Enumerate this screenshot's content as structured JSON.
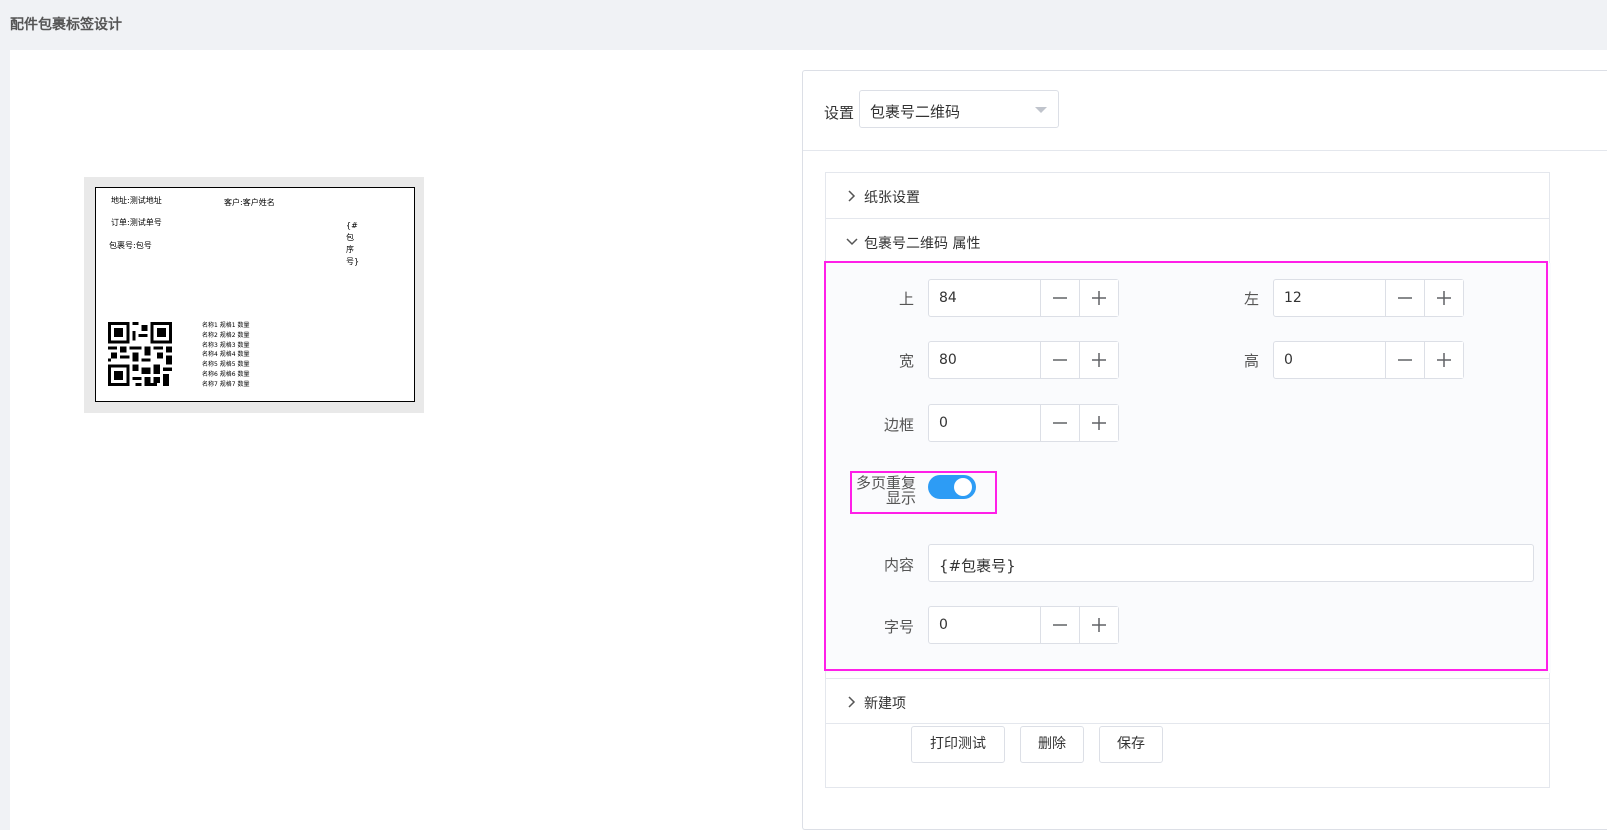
{
  "page": {
    "title": "配件包裹标签设计"
  },
  "label_preview": {
    "address": "地址:测试地址",
    "customer": "客户:客户姓名",
    "order": "订单:测试单号",
    "package_no": "包裹号:包号",
    "vertical_field": "{#包序号}",
    "items": [
      "名称1 规格1 数量",
      "名称2 规格2 数量",
      "名称3 规格3 数量",
      "名称4 规格4 数量",
      "名称5 规格5 数量",
      "名称6 规格6 数量",
      "名称7 规格7 数量"
    ]
  },
  "settings": {
    "label": "设置",
    "selected": "包裹号二维码",
    "sections": {
      "paper": "纸张设置",
      "props": "包裹号二维码 属性",
      "new_item": "新建项"
    },
    "fields": {
      "top": {
        "label": "上",
        "value": "84"
      },
      "left": {
        "label": "左",
        "value": "12"
      },
      "width": {
        "label": "宽",
        "value": "80"
      },
      "height": {
        "label": "高",
        "value": "0"
      },
      "border": {
        "label": "边框",
        "value": "0"
      },
      "repeat": {
        "label_line1": "多页重复",
        "label_line2": "显示",
        "on": true
      },
      "content": {
        "label": "内容",
        "value": "{#包裹号}"
      },
      "font_size": {
        "label": "字号",
        "value": "0"
      }
    },
    "buttons": {
      "print_test": "打印测试",
      "delete": "删除",
      "save": "保存"
    }
  },
  "colors": {
    "accent": "#2d9cf5",
    "highlight": "#ff1fe8"
  }
}
